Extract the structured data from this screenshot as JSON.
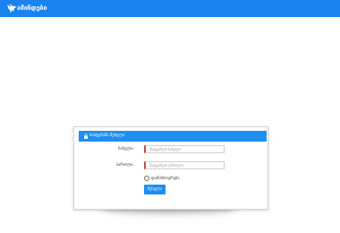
{
  "navbar": {
    "brand_name": "ამინდები",
    "logo_icon": "bird-icon",
    "background": "#1a83ee"
  },
  "login_panel": {
    "heading_icon": "lock-icon",
    "heading_text": "სისტემაში შესვლა",
    "username": {
      "label": "სახელი:",
      "value": "",
      "placeholder": "შეიყვანეთ სახელი"
    },
    "password": {
      "label": "პაროლი:",
      "value": "",
      "placeholder": "შეიყვანეთ პაროლი"
    },
    "remember_me": {
      "label": "დამახსოვრება",
      "checked": false
    },
    "submit_label": "შესვლა",
    "accent": "#1f8ef1"
  }
}
